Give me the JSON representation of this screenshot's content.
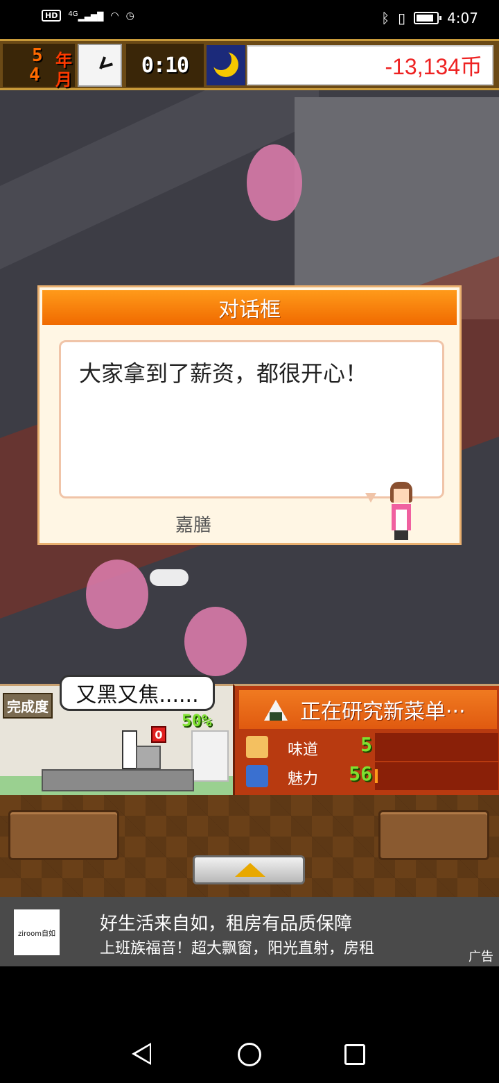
{
  "status_bar": {
    "network": "HD",
    "signal": "4G",
    "time": "4:07",
    "icons": [
      "hd-icon",
      "signal-icon",
      "wifi-icon",
      "alarm-icon",
      "bluetooth-icon",
      "vibrate-icon",
      "battery-icon"
    ]
  },
  "hud": {
    "year": "5",
    "year_unit": "年",
    "month": "4",
    "month_unit": "月",
    "time": "0:10",
    "money": "-13,134币"
  },
  "dialog": {
    "title": "对话框",
    "message": "大家拿到了薪资，都很开心！",
    "speaker": "嘉膳"
  },
  "kitchen": {
    "done_label": "完成度",
    "speech": "又黑又焦......",
    "progress_text": "50%",
    "progress": 0.5,
    "badge": "0"
  },
  "research": {
    "title": "正在研究新菜单···",
    "stats": [
      {
        "label": "味道",
        "value": "5",
        "icon": "taste-icon"
      },
      {
        "label": "魅力",
        "value": "56",
        "icon": "charm-icon"
      }
    ]
  },
  "ad": {
    "logo_text": "ziroom自如",
    "title": "好生活来自如，租房有品质保障",
    "subtitle": "上班族福音！超大飘窗，阳光直射，房租",
    "tag": "广告"
  },
  "colors": {
    "dialog_header": "#f07a10",
    "money_text": "#e22222",
    "stat_value": "#7ee030",
    "research_bg": "#b83a10"
  }
}
